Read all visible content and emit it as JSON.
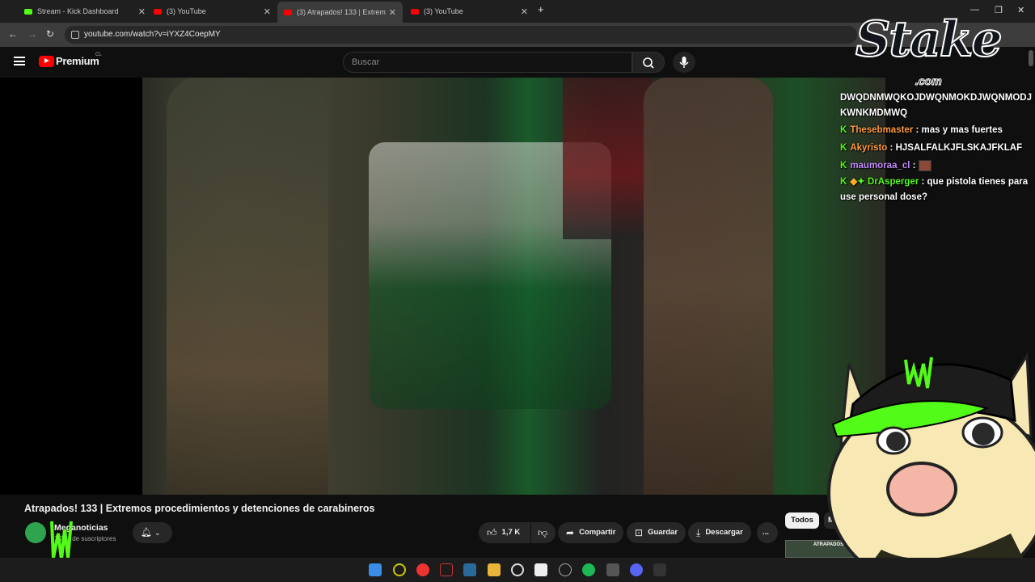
{
  "browser": {
    "tabs": [
      {
        "label": "Stream - Kick Dashboard",
        "active": false
      },
      {
        "label": "(3) YouTube",
        "active": false
      },
      {
        "label": "(3) Atrapados! 133 | Extrem",
        "active": true
      },
      {
        "label": "(3) YouTube",
        "active": false
      }
    ],
    "new_tab": "+",
    "close_glyph": "✕",
    "url": "youtube.com/watch?v=iYXZ4CoepMY"
  },
  "youtube": {
    "brand": "Premium",
    "country": "CL",
    "search_placeholder": "Buscar",
    "video_title": "Atrapados! 133 | Extremos procedimientos y detenciones de carabineros",
    "channel_name": "Meganoticias",
    "channel_subs": "1,7 M de suscriptores",
    "likes": "1,7 K",
    "share": "Compartir",
    "save": "Guardar",
    "download": "Descargar",
    "more": "...",
    "chip_all": "Todos",
    "chip_next": "M",
    "thumb_label": "ATRAPADOS!"
  },
  "overlay": {
    "stake_brand": "Stake",
    "stake_domain": ".com",
    "chat": [
      {
        "user": "",
        "text": "DWQDNMWQKOJDWQNMOKDJWQNMODJKWNKMDMWQ"
      },
      {
        "user": "Thesebmaster",
        "text": ": mas y mas fuertes"
      },
      {
        "user": "Akyristo",
        "text": ": HJSALFALKJFLSKAJFKLAF"
      },
      {
        "user": "maumoraa_cl",
        "text": ":"
      },
      {
        "user": "DrAsperger",
        "text": ": que pistola tienes para use personal dose?"
      }
    ],
    "kick_glyph": "K"
  },
  "colors": {
    "yt_red": "#ff0000",
    "kick_green": "#53fc18",
    "bg": "#0f0f0f"
  }
}
